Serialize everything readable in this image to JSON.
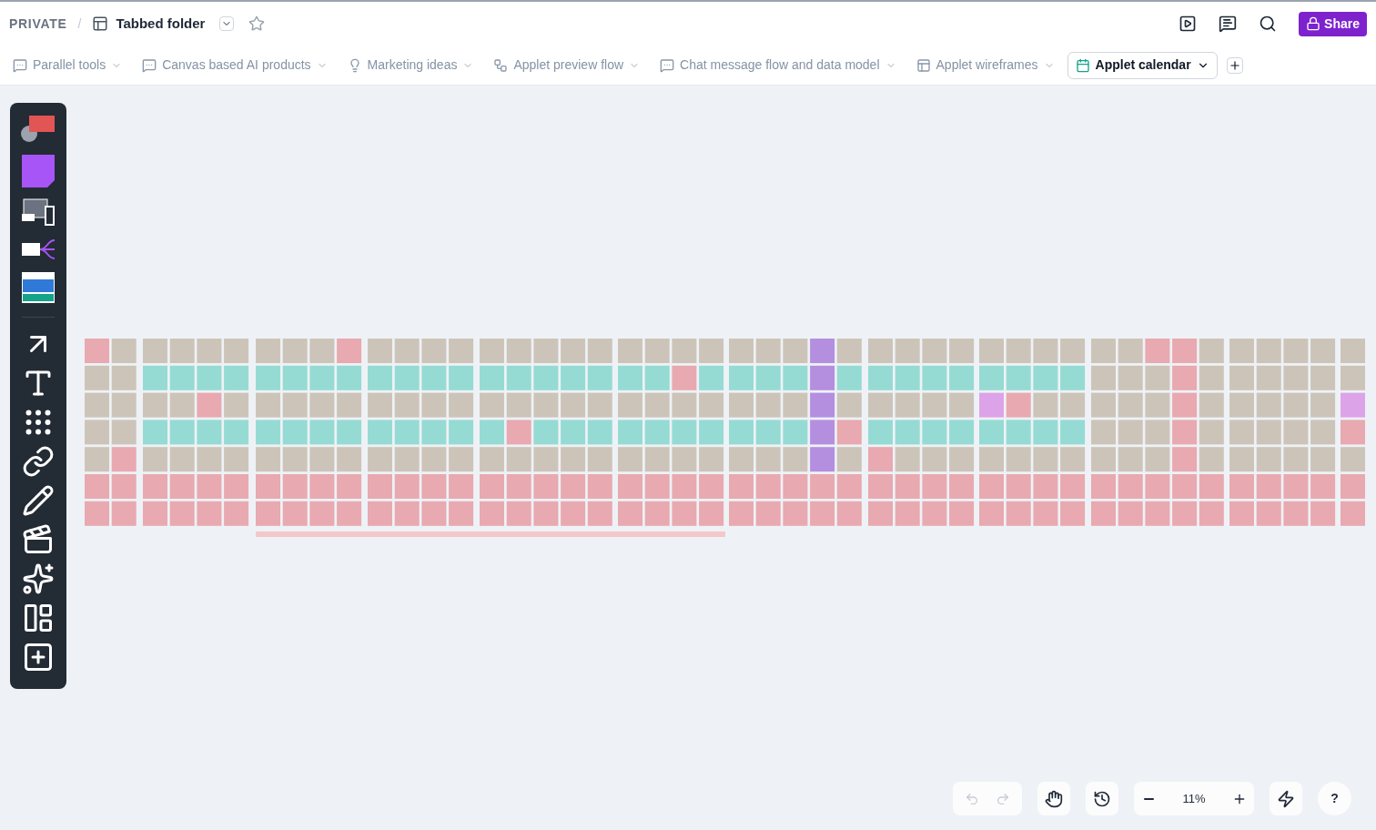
{
  "breadcrumb": {
    "space": "PRIVATE",
    "separator": "/",
    "title": "Tabbed folder"
  },
  "header_actions": {
    "share": "Share"
  },
  "tabs": [
    {
      "label": "Parallel tools",
      "kind": "chat",
      "selected": false
    },
    {
      "label": "Canvas based AI products",
      "kind": "chat",
      "selected": false
    },
    {
      "label": "Marketing ideas",
      "kind": "bulb",
      "selected": false
    },
    {
      "label": "Applet preview flow",
      "kind": "flow",
      "selected": false
    },
    {
      "label": "Chat message flow and data model",
      "kind": "chat",
      "selected": false
    },
    {
      "label": "Applet wireframes",
      "kind": "layout",
      "selected": false
    },
    {
      "label": "Applet calendar",
      "kind": "calendar",
      "selected": true
    }
  ],
  "history_controls": [
    {
      "kind": "undo",
      "disabled": true
    },
    {
      "kind": "redo",
      "disabled": true
    }
  ],
  "zoom": {
    "value": "11%"
  },
  "help": "?"
}
